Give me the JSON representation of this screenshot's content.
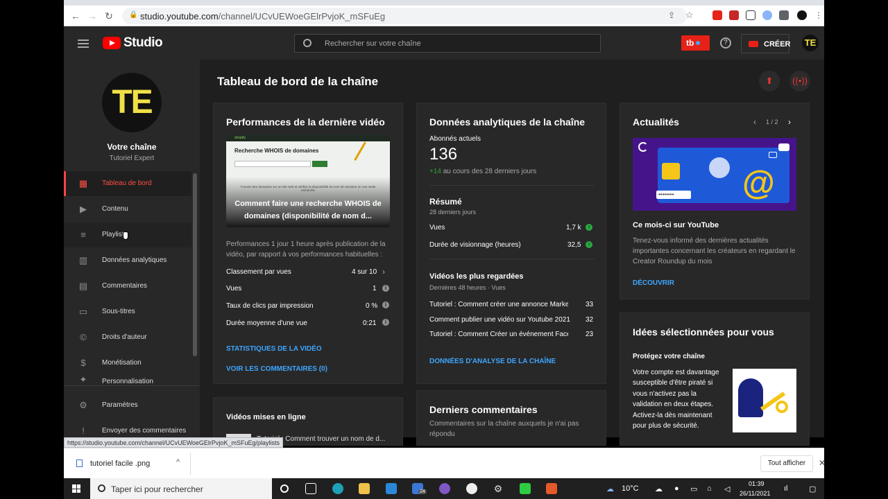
{
  "browser": {
    "url_host": "studio.youtube.com",
    "url_path": "/channel/UCvUEWoeGElrPvjoK_mSFuEg",
    "status_url": "https://studio.youtube.com/channel/UCvUEWoeGElrPvjoK_mSFuEg/playlists"
  },
  "header": {
    "logo": "Studio",
    "search_placeholder": "Rechercher sur votre chaîne",
    "badge": "tb",
    "create_label": "CRÉER",
    "avatar": "TE",
    "help": "?"
  },
  "sidebar": {
    "avatar": "TE",
    "channel_title": "Votre chaîne",
    "channel_name": "Tutoriel Expert",
    "items": [
      {
        "label": "Tableau de bord",
        "icon": "dashboard-icon",
        "glyph": "▦"
      },
      {
        "label": "Contenu",
        "icon": "content-icon",
        "glyph": "▶"
      },
      {
        "label": "Playlists",
        "icon": "playlists-icon",
        "glyph": "≡"
      },
      {
        "label": "Données analytiques",
        "icon": "analytics-icon",
        "glyph": "▥"
      },
      {
        "label": "Commentaires",
        "icon": "comments-icon",
        "glyph": "▤"
      },
      {
        "label": "Sous-titres",
        "icon": "subtitles-icon",
        "glyph": "▭"
      },
      {
        "label": "Droits d'auteur",
        "icon": "copyright-icon",
        "glyph": "©"
      },
      {
        "label": "Monétisation",
        "icon": "monetization-icon",
        "glyph": "$"
      },
      {
        "label": "Personnalisation",
        "icon": "customization-icon",
        "glyph": "✦"
      }
    ],
    "settings": "Paramètres",
    "feedback": "Envoyer des commentaires"
  },
  "main": {
    "title": "Tableau de bord de la chaîne",
    "latest_video": {
      "title": "Performances de la dernière vidéo",
      "thumb_caption": "Comment faire une recherche WHOIS de domaines (disponibilité de nom d...",
      "thumb_heading": "Recherche WHOIS de domaines",
      "thumb_text": "Trouvez des domaines sur un site web et vérifiez la disponibilité du nom de domaine en une seule recherche",
      "thumb_brand": "shopify",
      "description": "Performances 1 jour 1 heure après publication de la vidéo, par rapport à vos performances habituelles :",
      "rows": [
        {
          "label": "Classement par vues",
          "value": "4 sur 10"
        },
        {
          "label": "Vues",
          "value": "1"
        },
        {
          "label": "Taux de clics par impression",
          "value": "0 %"
        },
        {
          "label": "Durée moyenne d'une vue",
          "value": "0:21"
        }
      ],
      "link1": "STATISTIQUES DE LA VIDÉO",
      "link2": "VOIR LES COMMENTAIRES (0)"
    },
    "uploads": {
      "title": "Vidéos mises en ligne",
      "item": "Tutoriel : Comment trouver un nom de d..."
    },
    "analytics": {
      "title": "Données analytiques de la chaîne",
      "subs_label": "Abonnés actuels",
      "subs_value": "136",
      "subs_delta": "+14",
      "subs_period": "au cours des 28 derniers jours",
      "summary_title": "Résumé",
      "summary_period": "28 derniers jours",
      "summary_rows": [
        {
          "label": "Vues",
          "value": "1,7 k"
        },
        {
          "label": "Durée de visionnage (heures)",
          "value": "32,5"
        }
      ],
      "top_title": "Vidéos les plus regardées",
      "top_period": "Dernières 48 heures · Vues",
      "top_rows": [
        {
          "label": "Tutoriel : Comment créer une annonce Marketpl...",
          "value": "33"
        },
        {
          "label": "Comment publier une vidéo sur Youtube 2021",
          "value": "32"
        },
        {
          "label": "Tutoriel : Comment Créer un événement Facebo...",
          "value": "23"
        }
      ],
      "link": "DONNÉES D'ANALYSE DE LA CHAÎNE"
    },
    "comments": {
      "title": "Derniers commentaires",
      "subtitle": "Commentaires sur la chaîne auxquels je n'ai pas répondu"
    },
    "news": {
      "title": "Actualités",
      "pager": "1 / 2",
      "card_title": "Ce mois-ci sur YouTube",
      "card_text": "Tenez-vous informé des dernières actualités importantes concernant les créateurs en regardant le Creator Roundup du mois",
      "link": "DÉCOUVRIR",
      "img_password": "••••••••",
      "img_at": "@"
    },
    "ideas": {
      "title": "Idées sélectionnées pour vous",
      "subtitle": "Protégez votre chaîne",
      "text": "Votre compte est davantage susceptible d'être piraté si vous n'activez pas la validation en deux étapes. Activez-la dès maintenant pour plus de sécurité."
    }
  },
  "download": {
    "file": "tutoriel facile .png",
    "show_all": "Tout afficher"
  },
  "taskbar": {
    "search": "Taper ici pour rechercher",
    "temp": "10°C",
    "time": "01:39",
    "date": "26/11/2021",
    "badge": "24"
  }
}
